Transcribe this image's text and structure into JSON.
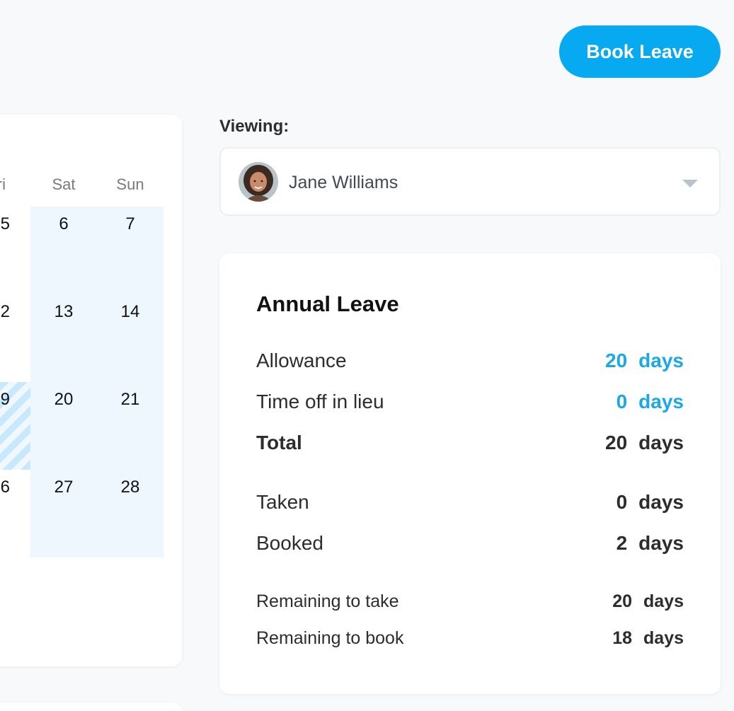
{
  "header": {
    "book_leave_label": "Book Leave"
  },
  "calendar": {
    "partial_header": "ri",
    "headers": [
      "Sat",
      "Sun"
    ],
    "partial_days": [
      "5",
      "2",
      "9",
      "6"
    ],
    "weeks": [
      [
        "6",
        "7"
      ],
      [
        "13",
        "14"
      ],
      [
        "20",
        "21"
      ],
      [
        "27",
        "28"
      ]
    ]
  },
  "viewing": {
    "label": "Viewing:",
    "selected_name": "Jane Williams"
  },
  "annual_leave": {
    "title": "Annual Leave",
    "unit": "days",
    "rows": [
      {
        "label": "Allowance",
        "value": "20"
      },
      {
        "label": "Time off in lieu",
        "value": "0"
      },
      {
        "label": "Total",
        "value": "20"
      },
      {
        "label": "Taken",
        "value": "0"
      },
      {
        "label": "Booked",
        "value": "2"
      },
      {
        "label": "Remaining to take",
        "value": "20"
      },
      {
        "label": "Remaining to book",
        "value": "18"
      }
    ]
  },
  "colors": {
    "accent": "#07aaf0",
    "value_blue": "#1aa8ea",
    "weekend_bg": "#eef7fe",
    "booked_hatch": "#c7e9fb"
  },
  "icons": {
    "dropdown": "chevron-down-icon",
    "avatar": "avatar"
  }
}
